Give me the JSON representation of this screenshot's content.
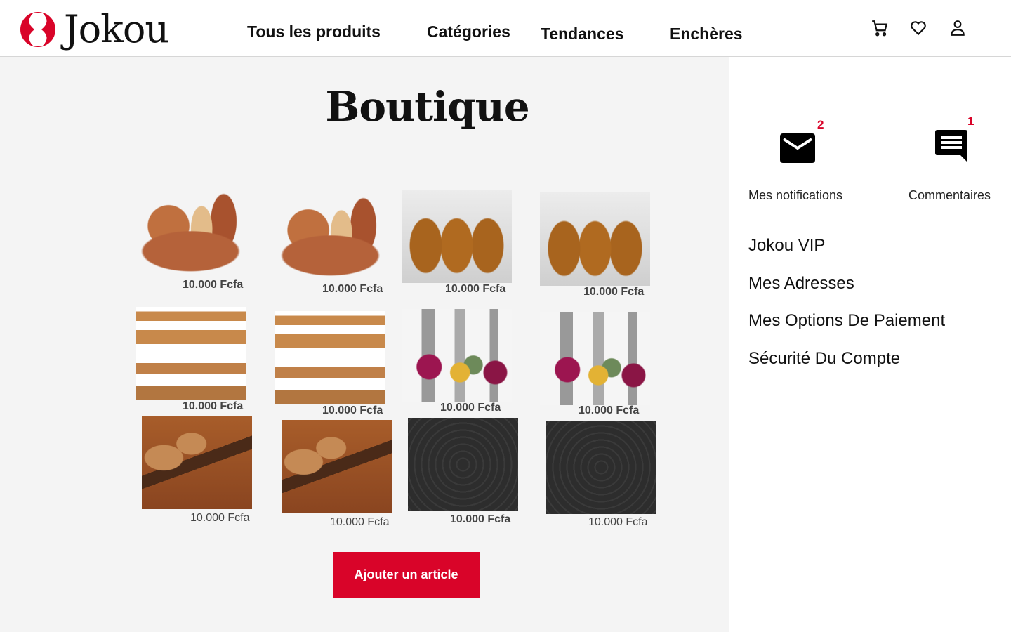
{
  "header": {
    "logo_text": "Jokou",
    "nav": [
      "Tous les produits",
      "Catégories",
      "Tendances",
      "Enchères"
    ],
    "icons": [
      "cart-icon",
      "heart-icon",
      "user-icon"
    ]
  },
  "main": {
    "title": "Boutique",
    "products": [
      {
        "price": "10.000 Fcfa",
        "image": "wooden-bowl-set"
      },
      {
        "price": "10.000 Fcfa",
        "image": "wooden-bowl-set"
      },
      {
        "price": "10.000 Fcfa",
        "image": "wooden-mortars"
      },
      {
        "price": "10.000 Fcfa",
        "image": "wooden-mortars"
      },
      {
        "price": "10.000 Fcfa",
        "image": "wooden-stools"
      },
      {
        "price": "10.000 Fcfa",
        "image": "wooden-stools"
      },
      {
        "price": "10.000 Fcfa",
        "image": "painted-vases"
      },
      {
        "price": "10.000 Fcfa",
        "image": "painted-vases"
      },
      {
        "price": "10.000 Fcfa",
        "image": "wooden-spoons"
      },
      {
        "price": "10.000 Fcfa",
        "image": "wooden-spoons"
      },
      {
        "price": "10.000 Fcfa",
        "image": "awale-board"
      },
      {
        "price": "10.000 Fcfa",
        "image": "awale-board"
      }
    ],
    "add_button": "Ajouter un article"
  },
  "sidebar": {
    "notifications": {
      "label": "Mes notifications",
      "count": "2"
    },
    "comments": {
      "label": "Commentaires",
      "count": "1"
    },
    "menu": [
      "Jokou VIP",
      "Mes Adresses",
      "Mes Options De Paiement",
      "Sécurité Du Compte"
    ]
  },
  "colors": {
    "accent": "#d90429"
  }
}
